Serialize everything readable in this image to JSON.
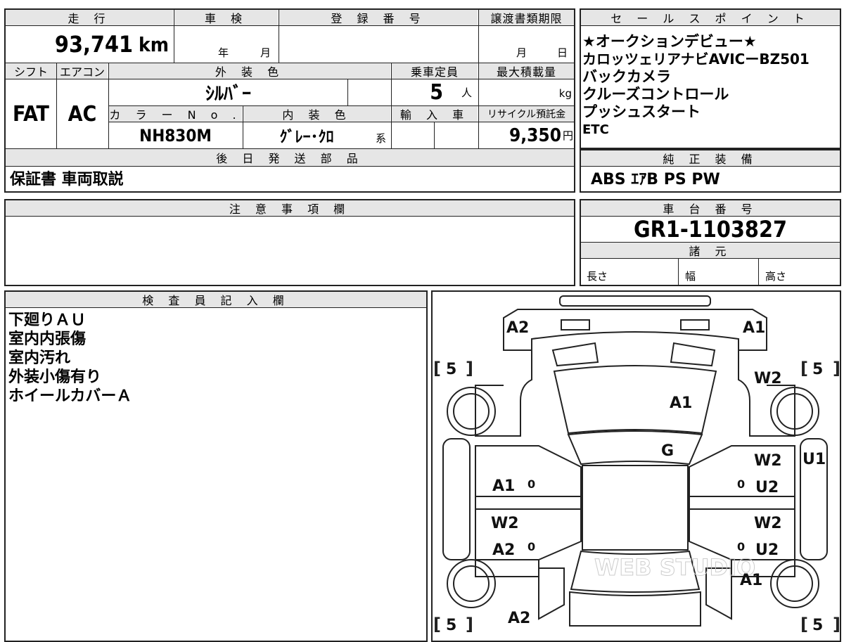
{
  "top_left_table": {
    "headers": {
      "mileage": "走 行",
      "inspection": "車 検",
      "registration": "登 録 番 号",
      "transfer_deadline": "譲渡書類期限",
      "shift": "シフト",
      "aircon": "エアコン",
      "exterior_color": "外 装 色",
      "capacity": "乗車定員",
      "max_load": "最大積載量",
      "color_no": "カ ラ ー N o .",
      "interior_color": "内 装 色",
      "import": "輸 入 車",
      "recycle": "リサイクル預託金",
      "later_parts": "後 日 発 送 部 品"
    },
    "values": {
      "mileage": "93,741",
      "mileage_unit": "km",
      "inspection_year_unit": "年",
      "inspection_month_unit": "月",
      "transfer_month_unit": "月",
      "transfer_day_unit": "日",
      "shift": "FAT",
      "aircon": "AC",
      "exterior_color": "ｼﾙﾊﾞｰ",
      "capacity": "5",
      "capacity_unit": "人",
      "max_load_unit": "kg",
      "color_no": "NH830M",
      "interior_color": "ｸﾞﾚｰ･ｸﾛ",
      "interior_suffix": "系",
      "recycle": "9,350",
      "recycle_unit": "円",
      "later_parts": "保証書 車両取説"
    }
  },
  "sales_points": {
    "header": "セ ー ル ス ポ イ ン ト",
    "lines": [
      "★オークションデビュー★",
      "カロッツェリアナビAVICーBZ501",
      "バックカメラ",
      "クルーズコントロール",
      "プッシュスタート",
      "ETC"
    ]
  },
  "genuine_equipment": {
    "header": "純 正 装 備",
    "value": "ABS ｴｱB PS PW"
  },
  "notes": {
    "header": "注 意 事 項 欄",
    "value": ""
  },
  "chassis": {
    "header": "車 台 番 号",
    "value": "GR1-1103827"
  },
  "specs": {
    "header": "諸 元",
    "length": "長さ",
    "width": "幅",
    "height": "高さ"
  },
  "inspector": {
    "header": "検 査 員 記 入 欄",
    "lines": [
      "下廻りＡＵ",
      "室内内張傷",
      "室内汚れ",
      "外装小傷有り",
      "ホイールカバーＡ"
    ]
  },
  "diagram": {
    "watermark": "WEB STUDIO",
    "marks": {
      "front_left": "A2",
      "front_right": "A1",
      "hood": "A1",
      "windshield": "G",
      "right_front_fender": "W2",
      "right_front_door_w": "W2",
      "right_front_door_u": "U2",
      "right_rear_door_w": "W2",
      "right_rear_door_u": "U2",
      "right_side_edge": "U1",
      "right_rear": "A1",
      "left_front_door": "A1",
      "left_rear_door_w": "W2",
      "left_rear_door_a": "A2",
      "rear": "A2",
      "tire_front_left": "5",
      "tire_front_right": "5",
      "tire_rear_left": "5",
      "tire_rear_right": "5",
      "zero_left_front": "0",
      "zero_right_front": "0",
      "zero_left_rear": "0",
      "zero_right_rear": "0",
      "bracket_open": "[",
      "bracket_close": "]"
    }
  }
}
